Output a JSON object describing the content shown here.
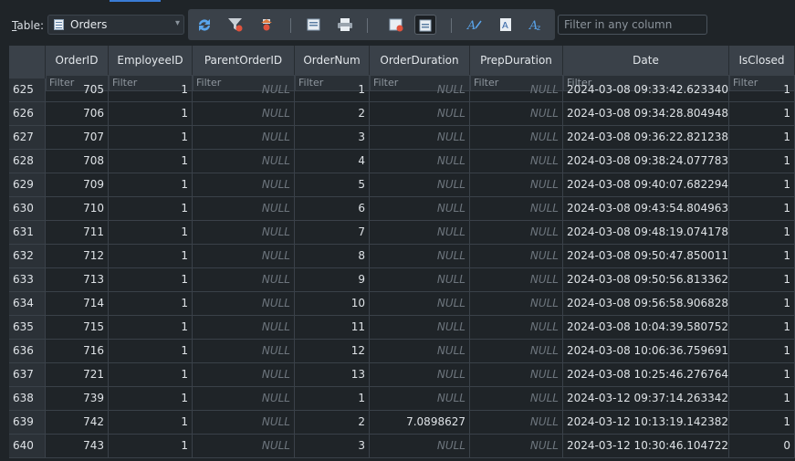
{
  "toolbar": {
    "table_label_prefix": "",
    "table_label_mnemonic": "T",
    "table_label_rest": "able:",
    "table_selected": "Orders",
    "filter_any_placeholder": "Filter in any column"
  },
  "grid": {
    "columns": [
      "OrderID",
      "EmployeeID",
      "ParentOrderID",
      "OrderNum",
      "OrderDuration",
      "PrepDuration",
      "Date",
      "IsClosed"
    ],
    "filter_placeholder": "Filter",
    "partial_row": {
      "rownum": "625",
      "OrderID": "705",
      "EmployeeID": "1",
      "ParentOrderID": "NULL",
      "OrderNum": "1",
      "OrderDuration": "NULL",
      "PrepDuration": "NULL",
      "Date": "2024-03-08 09:33:42.6233400",
      "IsClosed": "1"
    },
    "rows": [
      {
        "rownum": "626",
        "OrderID": "706",
        "EmployeeID": "1",
        "ParentOrderID": "NULL",
        "OrderNum": "2",
        "OrderDuration": "NULL",
        "PrepDuration": "NULL",
        "Date": "2024-03-08 09:34:28.8049481",
        "IsClosed": "1"
      },
      {
        "rownum": "627",
        "OrderID": "707",
        "EmployeeID": "1",
        "ParentOrderID": "NULL",
        "OrderNum": "3",
        "OrderDuration": "NULL",
        "PrepDuration": "NULL",
        "Date": "2024-03-08 09:36:22.8212389",
        "IsClosed": "1"
      },
      {
        "rownum": "628",
        "OrderID": "708",
        "EmployeeID": "1",
        "ParentOrderID": "NULL",
        "OrderNum": "4",
        "OrderDuration": "NULL",
        "PrepDuration": "NULL",
        "Date": "2024-03-08 09:38:24.0777836",
        "IsClosed": "1"
      },
      {
        "rownum": "629",
        "OrderID": "709",
        "EmployeeID": "1",
        "ParentOrderID": "NULL",
        "OrderNum": "5",
        "OrderDuration": "NULL",
        "PrepDuration": "NULL",
        "Date": "2024-03-08 09:40:07.6822943",
        "IsClosed": "1"
      },
      {
        "rownum": "630",
        "OrderID": "710",
        "EmployeeID": "1",
        "ParentOrderID": "NULL",
        "OrderNum": "6",
        "OrderDuration": "NULL",
        "PrepDuration": "NULL",
        "Date": "2024-03-08 09:43:54.804963",
        "IsClosed": "1"
      },
      {
        "rownum": "631",
        "OrderID": "711",
        "EmployeeID": "1",
        "ParentOrderID": "NULL",
        "OrderNum": "7",
        "OrderDuration": "NULL",
        "PrepDuration": "NULL",
        "Date": "2024-03-08 09:48:19.0741782",
        "IsClosed": "1"
      },
      {
        "rownum": "632",
        "OrderID": "712",
        "EmployeeID": "1",
        "ParentOrderID": "NULL",
        "OrderNum": "8",
        "OrderDuration": "NULL",
        "PrepDuration": "NULL",
        "Date": "2024-03-08 09:50:47.8500118",
        "IsClosed": "1"
      },
      {
        "rownum": "633",
        "OrderID": "713",
        "EmployeeID": "1",
        "ParentOrderID": "NULL",
        "OrderNum": "9",
        "OrderDuration": "NULL",
        "PrepDuration": "NULL",
        "Date": "2024-03-08 09:50:56.8133629",
        "IsClosed": "1"
      },
      {
        "rownum": "634",
        "OrderID": "714",
        "EmployeeID": "1",
        "ParentOrderID": "NULL",
        "OrderNum": "10",
        "OrderDuration": "NULL",
        "PrepDuration": "NULL",
        "Date": "2024-03-08 09:56:58.9068283",
        "IsClosed": "1"
      },
      {
        "rownum": "635",
        "OrderID": "715",
        "EmployeeID": "1",
        "ParentOrderID": "NULL",
        "OrderNum": "11",
        "OrderDuration": "NULL",
        "PrepDuration": "NULL",
        "Date": "2024-03-08 10:04:39.5807521",
        "IsClosed": "1"
      },
      {
        "rownum": "636",
        "OrderID": "716",
        "EmployeeID": "1",
        "ParentOrderID": "NULL",
        "OrderNum": "12",
        "OrderDuration": "NULL",
        "PrepDuration": "NULL",
        "Date": "2024-03-08 10:06:36.7596918",
        "IsClosed": "1"
      },
      {
        "rownum": "637",
        "OrderID": "721",
        "EmployeeID": "1",
        "ParentOrderID": "NULL",
        "OrderNum": "13",
        "OrderDuration": "NULL",
        "PrepDuration": "NULL",
        "Date": "2024-03-08 10:25:46.2767648",
        "IsClosed": "1"
      },
      {
        "rownum": "638",
        "OrderID": "739",
        "EmployeeID": "1",
        "ParentOrderID": "NULL",
        "OrderNum": "1",
        "OrderDuration": "NULL",
        "PrepDuration": "NULL",
        "Date": "2024-03-12 09:37:14.2633424",
        "IsClosed": "1"
      },
      {
        "rownum": "639",
        "OrderID": "742",
        "EmployeeID": "1",
        "ParentOrderID": "NULL",
        "OrderNum": "2",
        "OrderDuration": "7.0898627",
        "PrepDuration": "NULL",
        "Date": "2024-03-12 10:13:19.1423828",
        "IsClosed": "1"
      },
      {
        "rownum": "640",
        "OrderID": "743",
        "EmployeeID": "1",
        "ParentOrderID": "NULL",
        "OrderNum": "3",
        "OrderDuration": "NULL",
        "PrepDuration": "NULL",
        "Date": "2024-03-12 10:30:46.1047229",
        "IsClosed": "0"
      }
    ]
  },
  "icons": [
    "refresh-icon",
    "clear-filters-icon",
    "delete-record-icon",
    "save-table-icon",
    "print-icon",
    "new-record-icon",
    "show-record-icon",
    "font-icon",
    "text-icon",
    "encoding-icon"
  ],
  "colors": {
    "header_bg": "#3a4149",
    "grid_bg": "#1f2428",
    "null_text": "#6d757d",
    "accent": "#3a7bd5"
  }
}
